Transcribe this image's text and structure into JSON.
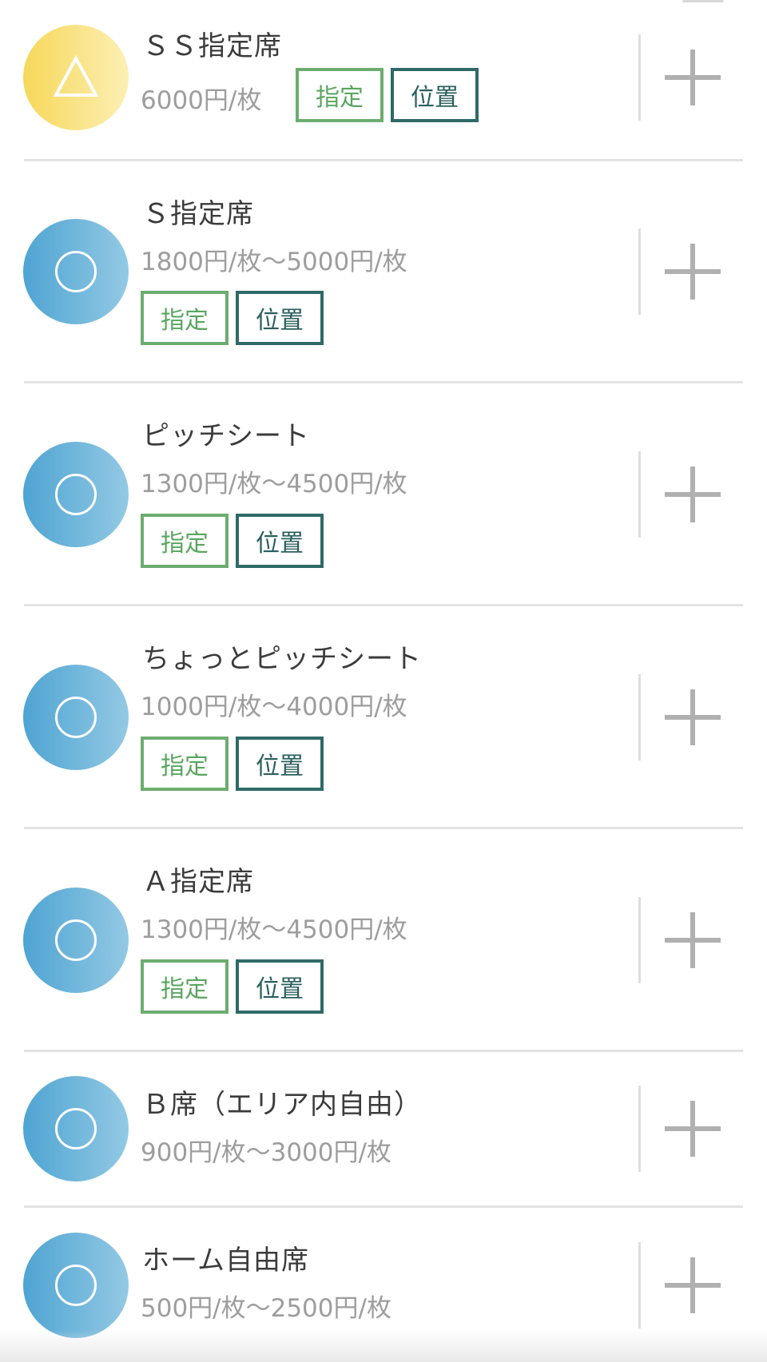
{
  "tags": {
    "designated_label": "指定",
    "location_label": "位置"
  },
  "seats": [
    {
      "name": "ＳＳ指定席",
      "price": "6000円/枚",
      "availability": "triangle"
    },
    {
      "name": "Ｓ指定席",
      "price": "1800円/枚～5000円/枚",
      "availability": "circle"
    },
    {
      "name": "ピッチシート",
      "price": "1300円/枚～4500円/枚",
      "availability": "circle"
    },
    {
      "name": "ちょっとピッチシート",
      "price": "1000円/枚～4000円/枚",
      "availability": "circle"
    },
    {
      "name": "Ａ指定席",
      "price": "1300円/枚～4500円/枚",
      "availability": "circle"
    },
    {
      "name": "Ｂ席（エリア内自由）",
      "price": "900円/枚～3000円/枚",
      "availability": "circle"
    },
    {
      "name": "ホーム自由席",
      "price": "500円/枚～2500円/枚",
      "availability": "circle"
    }
  ],
  "colors": {
    "circle_gradient_start": "#4fa4d2",
    "triangle_gradient_start": "#f6d85a",
    "designated_tag": "#6cad6f",
    "location_tag": "#2f6a68"
  }
}
